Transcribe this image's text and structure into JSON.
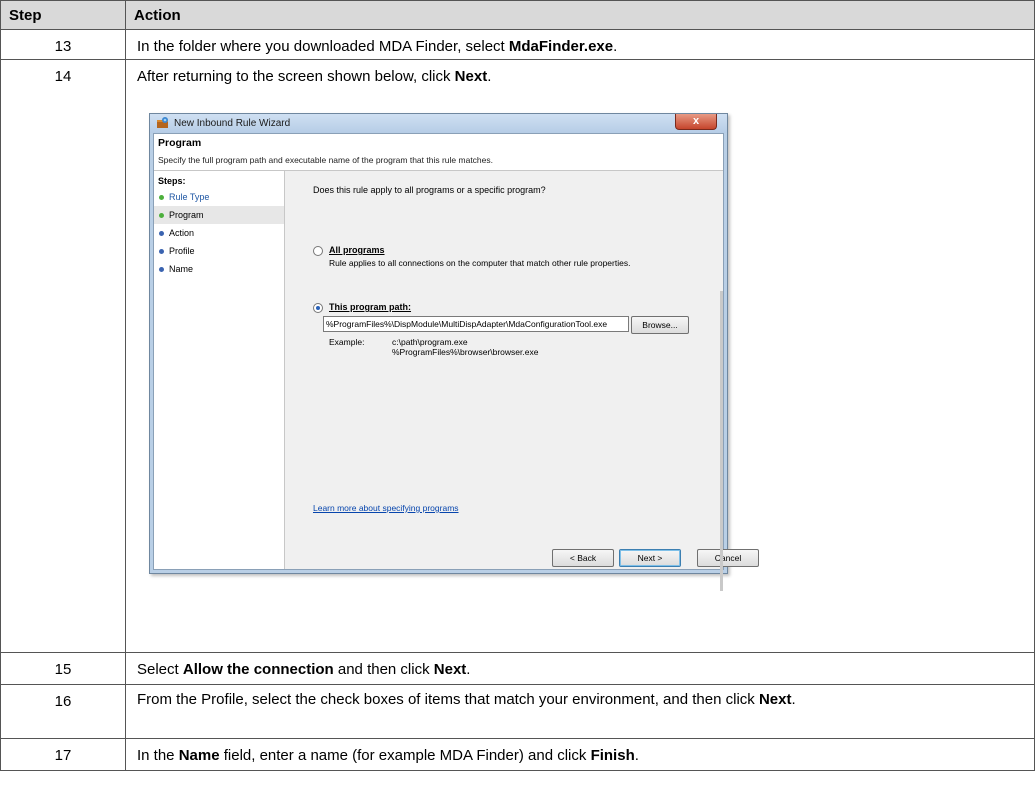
{
  "table": {
    "header_step": "Step",
    "header_action": "Action",
    "rows": [
      {
        "step": "13",
        "pre": "In the folder where you downloaded MDA Finder, select ",
        "b1": "MdaFinder.exe",
        "post": "."
      },
      {
        "step": "14",
        "pre": "After returning to the screen shown below, click ",
        "b1": "Next",
        "post": "."
      },
      {
        "step": "15",
        "pre": "Select ",
        "b1": "Allow the connection",
        "mid": " and then click ",
        "b2": "Next",
        "post": "."
      },
      {
        "step": "16",
        "pre": "From the Profile, select the check boxes of items that match your environment, and then click ",
        "b1": "Next",
        "post": "."
      },
      {
        "step": "17",
        "pre": "In the ",
        "b1": "Name",
        "mid": " field, enter a name (for example MDA Finder) and click ",
        "b2": "Finish",
        "post": "."
      }
    ]
  },
  "dialog": {
    "title": "New Inbound Rule Wizard",
    "close_label": "x",
    "heading": "Program",
    "subheading": "Specify the full program path and executable name of the program that this rule matches.",
    "steps_label": "Steps:",
    "steps": [
      "Rule Type",
      "Program",
      "Action",
      "Profile",
      "Name"
    ],
    "question": "Does this rule apply to all programs or a specific program?",
    "all_programs_label": "All programs",
    "all_programs_desc": "Rule applies to all connections on the computer that match other rule properties.",
    "this_program_label": "This program path:",
    "path_value": "%ProgramFiles%\\DispModule\\MultiDispAdapter\\MdaConfigurationTool.exe",
    "browse_label": "Browse...",
    "example_label": "Example:",
    "example_1": "c:\\path\\program.exe",
    "example_2": "%ProgramFiles%\\browser\\browser.exe",
    "learn_more": "Learn more about specifying programs",
    "back_label": "< Back",
    "next_label": "Next >",
    "cancel_label": "Cancel",
    "colors": {
      "done": "#4caf3c",
      "pending": "#3a63b0"
    }
  }
}
